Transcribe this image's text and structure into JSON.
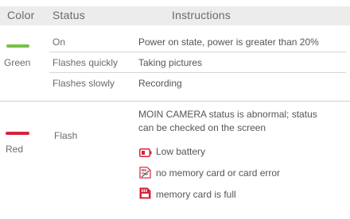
{
  "header": {
    "color": "Color",
    "status": "Status",
    "instructions": "Instructions"
  },
  "green_section": {
    "color_name": "Green",
    "indicator_color": "#77c043",
    "rows": [
      {
        "status": "On",
        "instruction": "Power on state, power is greater than 20%"
      },
      {
        "status": "Flashes quickly",
        "instruction": "Taking pictures"
      },
      {
        "status": "Flashes slowly",
        "instruction": "Recording"
      }
    ]
  },
  "red_section": {
    "color_name": "Red",
    "indicator_color": "#d8213b",
    "status": "Flash",
    "description_line1": "MOIN CAMERA status is abnormal; status",
    "description_line2": "can be checked on the screen",
    "items": [
      {
        "icon": "low-battery-icon",
        "label": "Low battery"
      },
      {
        "icon": "no-memory-card-icon",
        "label": "no memory card or card error"
      },
      {
        "icon": "memory-card-full-icon",
        "label": "memory card is full"
      }
    ]
  }
}
